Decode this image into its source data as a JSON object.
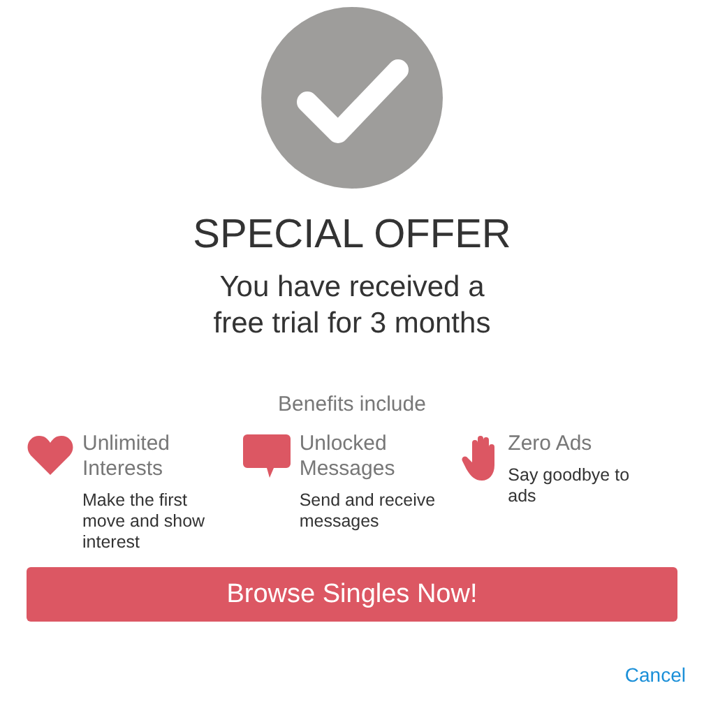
{
  "title": "SPECIAL OFFER",
  "subtitle": "You have received a free trial for 3 months",
  "benefits_heading": "Benefits include",
  "benefits": [
    {
      "kind": "heart",
      "title": "Unlimited Interests",
      "description": "Make the first move and show interest"
    },
    {
      "kind": "chat",
      "title": "Unlocked Messages",
      "description": "Send and receive messages"
    },
    {
      "kind": "hand",
      "title": "Zero Ads",
      "description": "Say goodbye to ads"
    }
  ],
  "primary_button": "Browse Singles Now!",
  "cancel_link": "Cancel"
}
